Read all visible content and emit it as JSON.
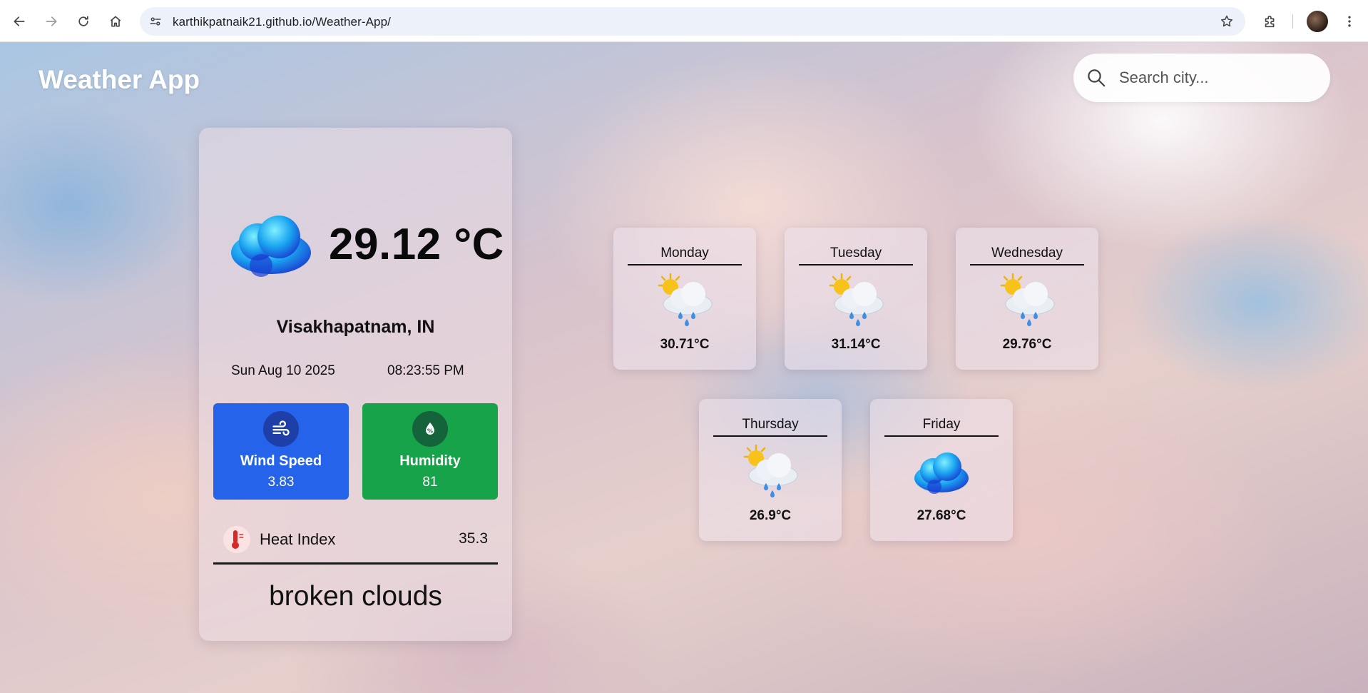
{
  "browser": {
    "url": "karthikpatnaik21.github.io/Weather-App/",
    "back_icon": "back-arrow-icon",
    "forward_icon": "forward-arrow-icon",
    "reload_icon": "reload-icon",
    "home_icon": "home-icon",
    "site_info_icon": "site-settings-icon",
    "bookmark_icon": "star-icon",
    "extensions_icon": "puzzle-icon"
  },
  "app": {
    "title": "Weather App",
    "search_placeholder": "Search city..."
  },
  "current": {
    "icon": "cloud-icon",
    "temperature": "29.12 °C",
    "location": "Visakhapatnam, IN",
    "date": "Sun Aug 10 2025",
    "time": "08:23:55 PM",
    "wind": {
      "label": "Wind Speed",
      "value": "3.83",
      "icon": "wind-icon",
      "color": "#2563eb"
    },
    "humidity": {
      "label": "Humidity",
      "value": "81",
      "icon": "humidity-drop-icon",
      "color": "#16a34a"
    },
    "heat_index": {
      "label": "Heat Index",
      "value": "35.3",
      "icon": "thermometer-icon"
    },
    "description": "broken clouds"
  },
  "forecast": [
    {
      "day": "Monday",
      "temp": "30.71°C",
      "icon": "sun-cloud-rain-icon"
    },
    {
      "day": "Tuesday",
      "temp": "31.14°C",
      "icon": "sun-cloud-rain-icon"
    },
    {
      "day": "Wednesday",
      "temp": "29.76°C",
      "icon": "sun-cloud-rain-icon"
    },
    {
      "day": "Thursday",
      "temp": "26.9°C",
      "icon": "sun-cloud-rain-icon"
    },
    {
      "day": "Friday",
      "temp": "27.68°C",
      "icon": "cloud-icon"
    }
  ]
}
